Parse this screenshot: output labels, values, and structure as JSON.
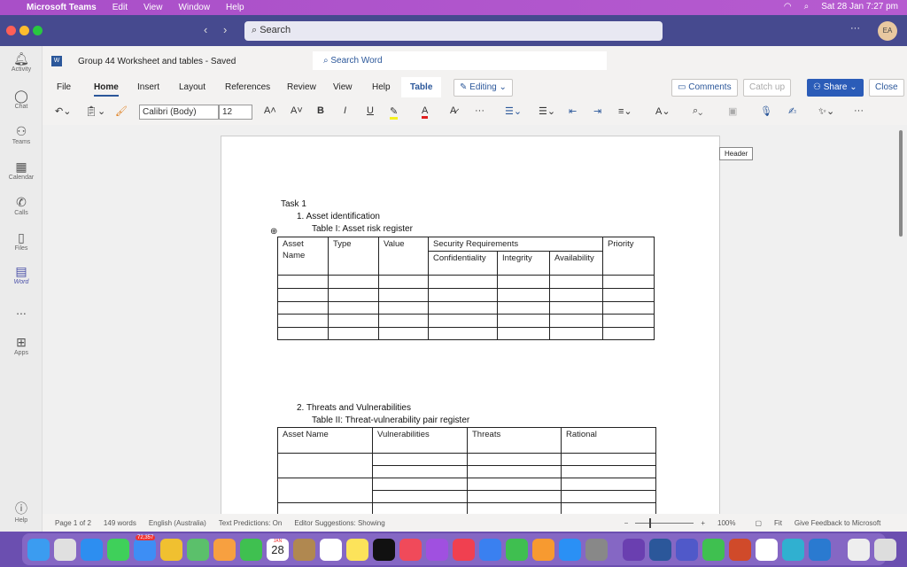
{
  "menubar": {
    "app": "Microsoft Teams",
    "items": [
      "Edit",
      "View",
      "Window",
      "Help"
    ],
    "clock": "Sat 28 Jan  7:27 pm"
  },
  "titlebar": {
    "search_placeholder": "Search",
    "avatar": "EA"
  },
  "sidebar": {
    "items": [
      {
        "label": "Activity",
        "icon": "bell-icon"
      },
      {
        "label": "Chat",
        "icon": "chat-icon"
      },
      {
        "label": "Teams",
        "icon": "teams-icon"
      },
      {
        "label": "Calendar",
        "icon": "calendar-icon"
      },
      {
        "label": "Calls",
        "icon": "phone-icon"
      },
      {
        "label": "Files",
        "icon": "file-icon"
      },
      {
        "label": "Word",
        "icon": "word-icon"
      },
      {
        "label": "...",
        "icon": "more-icon"
      },
      {
        "label": "Apps",
        "icon": "apps-icon"
      },
      {
        "label": "Help",
        "icon": "help-icon"
      }
    ]
  },
  "word": {
    "doc_title": "Group 44 Worksheet and tables  -  Saved",
    "search_placeholder": "Search Word",
    "tabs": [
      "File",
      "Home",
      "Insert",
      "Layout",
      "References",
      "Review",
      "View",
      "Help",
      "Table"
    ],
    "editing": "Editing",
    "comments": "Comments",
    "catchup": "Catch up",
    "share": "Share",
    "close": "Close",
    "font": "Calibri (Body)",
    "font_size": "12",
    "header_label": "Header"
  },
  "document": {
    "task": "Task 1",
    "h1": "1.   Asset identification",
    "t1_caption": "Table I: Asset risk register",
    "t1_headers": {
      "asset": "Asset Name",
      "type": "Type",
      "value": "Value",
      "sec": "Security Requirements",
      "priority": "Priority",
      "conf": "Confidentiality",
      "integ": "Integrity",
      "avail": "Availability"
    },
    "h2": "2.   Threats and Vulnerabilities",
    "t2_caption": "Table II: Threat-vulnerability pair register",
    "t2_headers": [
      "Asset Name",
      "Vulnerabilities",
      "Threats",
      "Rational"
    ]
  },
  "status": {
    "page": "Page 1 of 2",
    "words": "149 words",
    "lang": "English (Australia)",
    "pred": "Text Predictions: On",
    "editor": "Editor Suggestions: Showing",
    "zoom": "100%",
    "fit": "Fit",
    "feedback": "Give Feedback to Microsoft"
  },
  "dock": {
    "apps": [
      [
        "finder",
        "#3b9cf0"
      ],
      [
        "launchpad",
        "#e0e0e0"
      ],
      [
        "safari",
        "#2d8ef0"
      ],
      [
        "messages",
        "#3fd05a"
      ],
      [
        "mail",
        "#3d8ef5"
      ],
      [
        "chrome",
        "#f0c030"
      ],
      [
        "maps",
        "#5bc06b"
      ],
      [
        "photos",
        "#f7a040"
      ],
      [
        "facetime",
        "#3fc050"
      ],
      [
        "calendar",
        "#ffffff"
      ],
      [
        "contacts",
        "#b08850"
      ],
      [
        "reminders",
        "#ffffff"
      ],
      [
        "notes",
        "#fce35a"
      ],
      [
        "tv",
        "#111111"
      ],
      [
        "music",
        "#f04a5a"
      ],
      [
        "podcasts",
        "#a050e0"
      ],
      [
        "news",
        "#f04050"
      ],
      [
        "keynote",
        "#3a80f0"
      ],
      [
        "numbers",
        "#3fbf50"
      ],
      [
        "pages",
        "#f79a30"
      ],
      [
        "app-store",
        "#2a90f5"
      ],
      [
        "settings",
        "#888888"
      ],
      [
        "github",
        "#6a3fb0"
      ],
      [
        "word",
        "#2b579a"
      ],
      [
        "teams",
        "#5059c9"
      ],
      [
        "whatsapp",
        "#3fc050"
      ],
      [
        "powerpoint",
        "#d04a2a"
      ],
      [
        "mongodb",
        "#ffffff"
      ],
      [
        "canva",
        "#30b0d0"
      ],
      [
        "vscode",
        "#2a7ad0"
      ],
      [
        "downloads",
        "#eeeeee"
      ],
      [
        "trash",
        "#dddddd"
      ]
    ],
    "mail_badge": "72,357",
    "cal_month": "JAN",
    "cal_day": "28"
  }
}
